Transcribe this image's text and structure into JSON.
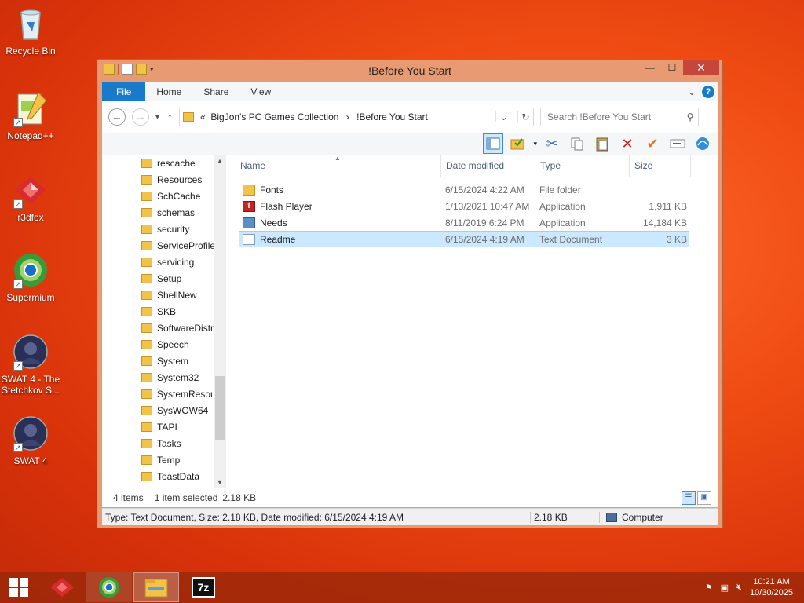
{
  "desktop": {
    "icons": [
      {
        "label": "Recycle Bin",
        "icon": "recycle-bin-icon"
      },
      {
        "label": "Notepad++",
        "icon": "notepadpp-icon"
      },
      {
        "label": "r3dfox",
        "icon": "r3dfox-icon"
      },
      {
        "label": "Supermium",
        "icon": "supermium-icon"
      },
      {
        "label": "SWAT 4 - The Stetchkov S...",
        "icon": "swat4-expansion-icon"
      },
      {
        "label": "SWAT 4",
        "icon": "swat4-icon"
      }
    ]
  },
  "window": {
    "title": "!Before You Start",
    "controls": {
      "minimize": "—",
      "maximize": "☐",
      "close": "✕"
    },
    "ribbon_tabs": [
      "File",
      "Home",
      "Share",
      "View"
    ],
    "address": {
      "prefix": "«",
      "crumbs": [
        "BigJon's PC Games Collection",
        "!Before You Start"
      ],
      "separator": "›"
    },
    "search": {
      "placeholder": "Search !Before You Start"
    },
    "nav_pane": [
      "rescache",
      "Resources",
      "SchCache",
      "schemas",
      "security",
      "ServiceProfiles",
      "servicing",
      "Setup",
      "ShellNew",
      "SKB",
      "SoftwareDistribution",
      "Speech",
      "System",
      "System32",
      "SystemResources",
      "SysWOW64",
      "TAPI",
      "Tasks",
      "Temp",
      "ToastData"
    ],
    "columns": {
      "name": "Name",
      "date": "Date modified",
      "type": "Type",
      "size": "Size"
    },
    "files": [
      {
        "name": "Fonts",
        "date": "6/15/2024 4:22 AM",
        "type": "File folder",
        "size": "",
        "icon": "folder-icon"
      },
      {
        "name": "Flash Player",
        "date": "1/13/2021 10:47 AM",
        "type": "Application",
        "size": "1,911 KB",
        "icon": "flash-player-icon"
      },
      {
        "name": "Needs",
        "date": "8/11/2019 6:24 PM",
        "type": "Application",
        "size": "14,184 KB",
        "icon": "application-icon"
      },
      {
        "name": "Readme",
        "date": "6/15/2024 4:19 AM",
        "type": "Text Document",
        "size": "3 KB",
        "icon": "text-document-icon",
        "selected": true
      }
    ],
    "status": {
      "items": "4 items",
      "selected": "1 item selected",
      "selected_size": "2.18 KB"
    },
    "statusbar": {
      "details": "Type: Text Document, Size: 2.18 KB, Date modified: 6/15/2024 4:19 AM",
      "size": "2.18 KB",
      "location": "Computer"
    }
  },
  "taskbar": {
    "clock": {
      "time": "10:21 AM",
      "date": "10/30/2025"
    },
    "items": [
      "r3dfox",
      "Supermium",
      "File Explorer",
      "7-Zip"
    ],
    "seven_zip_label": "7z"
  },
  "colors": {
    "accent": "#1979ca",
    "window_frame": "#e89b73",
    "selection": "#cce8ff",
    "close": "#c7463a"
  }
}
